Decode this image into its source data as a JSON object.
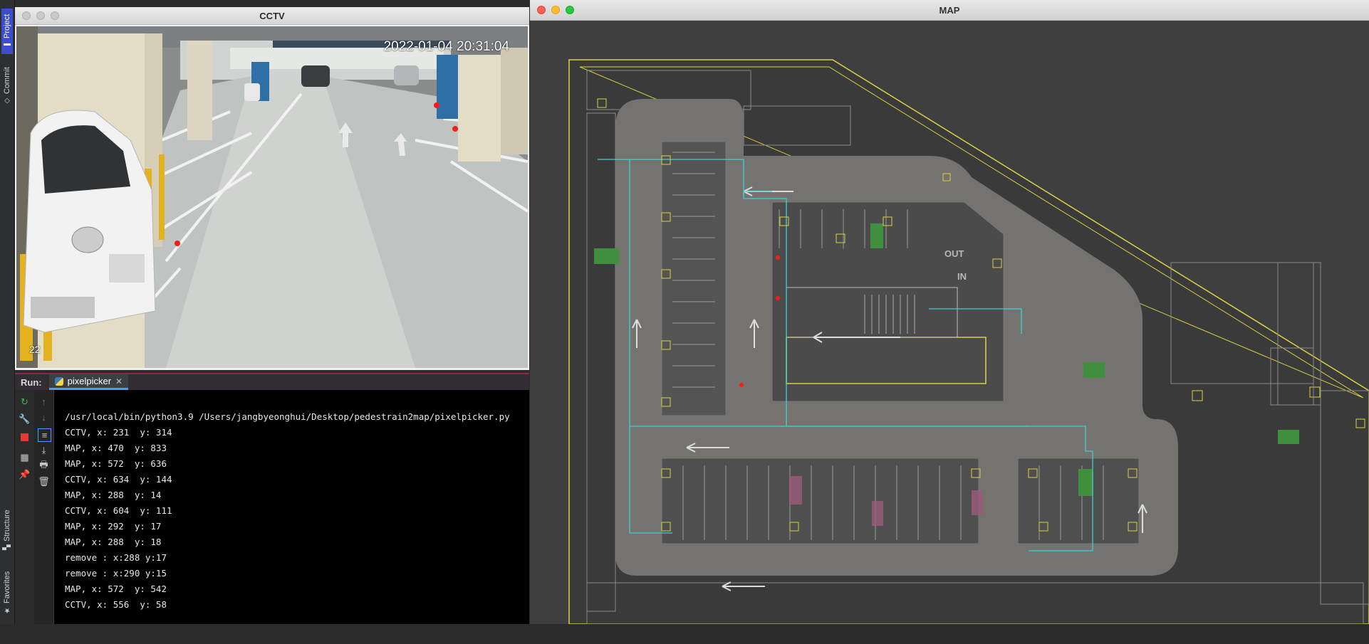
{
  "ide": {
    "tabs": [
      {
        "label": "Project",
        "icon": "folder-icon"
      },
      {
        "label": "Commit",
        "icon": "commit-icon"
      },
      {
        "label": "Structure",
        "icon": "structure-icon"
      },
      {
        "label": "Favorites",
        "icon": "star-icon"
      }
    ]
  },
  "cctv_window": {
    "title": "CCTV",
    "timestamp": "2022-01-04 20:31:04",
    "camera_id": "22"
  },
  "map_window": {
    "title": "MAP",
    "labels": {
      "out": "OUT",
      "in": "IN"
    }
  },
  "run_panel": {
    "label": "Run:",
    "tab_label": "pixelpicker",
    "lines": [
      "/usr/local/bin/python3.9 /Users/jangbyeonghui/Desktop/pedestrain2map/pixelpicker.py",
      "CCTV, x: 231  y: 314",
      "MAP, x: 470  y: 833",
      "MAP, x: 572  y: 636",
      "CCTV, x: 634  y: 144",
      "MAP, x: 288  y: 14",
      "CCTV, x: 604  y: 111",
      "MAP, x: 292  y: 17",
      "MAP, x: 288  y: 18",
      "remove : x:288 y:17",
      "remove : x:290 y:15",
      "MAP, x: 572  y: 542",
      "CCTV, x: 556  y: 58"
    ]
  },
  "colors": {
    "accent_blue": "#3d4dcc",
    "point_red": "#ff1a1a",
    "map_outline_yellow": "#d8d246",
    "map_route_cyan": "#3fd0d6",
    "map_green": "#3f8f3f"
  }
}
